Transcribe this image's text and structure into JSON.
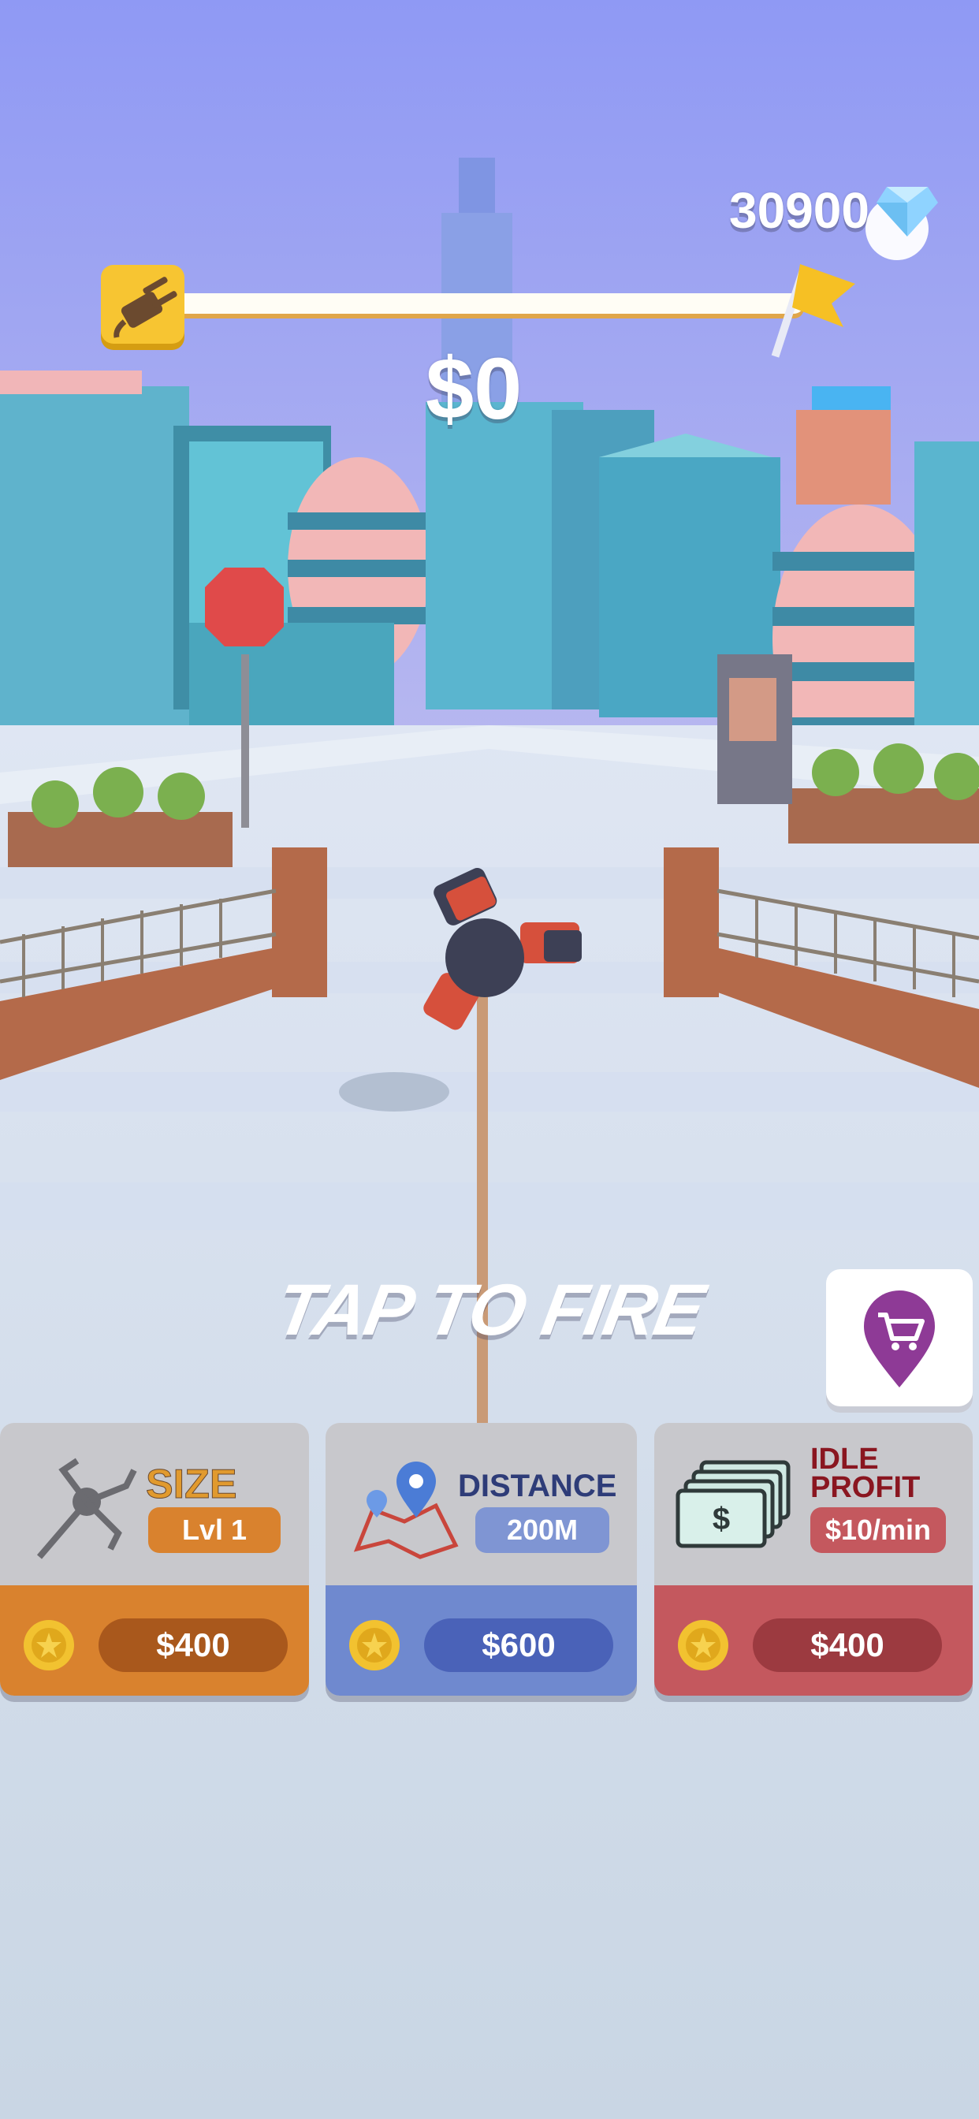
{
  "hud": {
    "gems": "30900",
    "money": "$0"
  },
  "prompt": "TAP TO FIRE",
  "cards": [
    {
      "title_line1": "SIZE",
      "title_line2": "",
      "badge": "Lvl 1",
      "price": "$400"
    },
    {
      "title_line1": "DISTANCE",
      "title_line2": "",
      "badge": "200M",
      "price": "$600"
    },
    {
      "title_line1": "IDLE",
      "title_line2": "PROFIT",
      "badge": "$10/min",
      "price": "$400"
    }
  ],
  "colors": {
    "sky": "#9aa3f0",
    "ground": "#c9d6e4",
    "size_card": "#d9822e",
    "distance_card": "#6f89cf",
    "idle_card": "#c4585e",
    "coin": "#f2c230"
  }
}
